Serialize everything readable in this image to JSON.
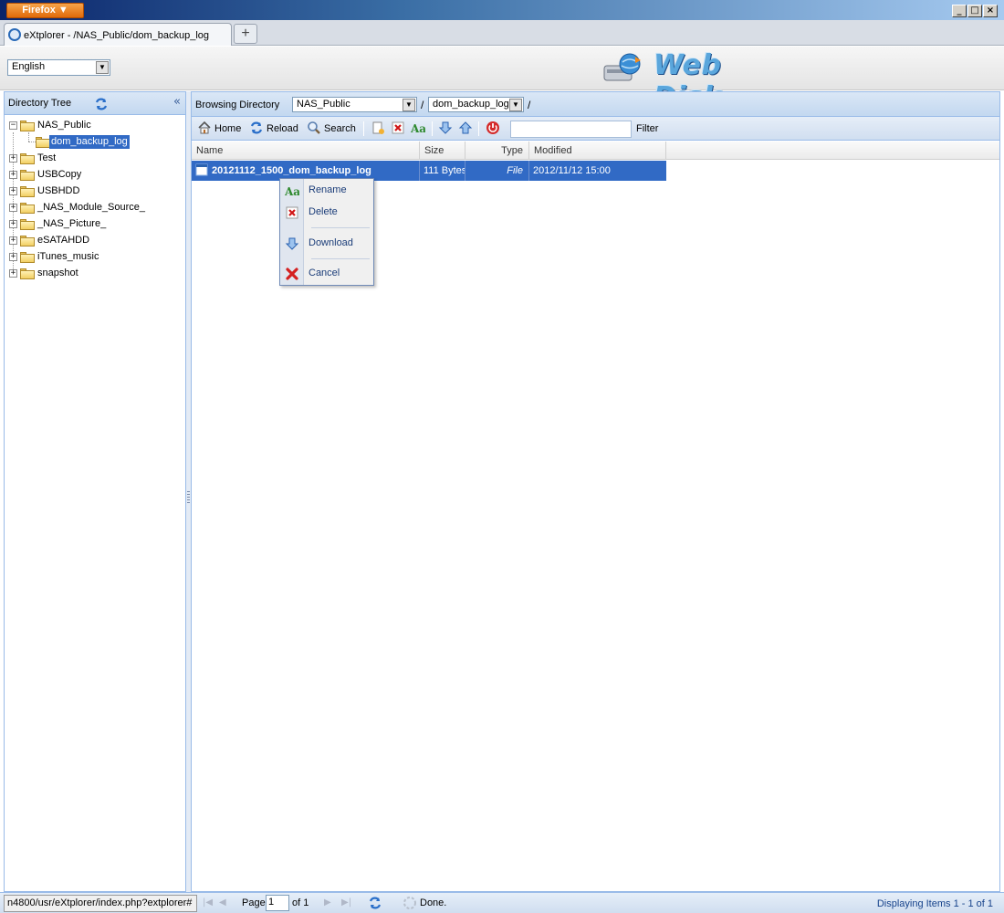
{
  "window": {
    "browser_button": "Firefox ▼",
    "minimize": "_",
    "maximize": "□",
    "close": "×",
    "tab_title": "eXtplorer - /NAS_Public/dom_backup_log",
    "new_tab": "+"
  },
  "header": {
    "language": "English",
    "logo_text": "Web Disk"
  },
  "tree": {
    "title": "Directory Tree",
    "collapse": "«",
    "nodes": [
      {
        "label": "NAS_Public",
        "expanded": true
      },
      {
        "label": "dom_backup_log",
        "selected": true
      },
      {
        "label": "Test"
      },
      {
        "label": "USBCopy"
      },
      {
        "label": "USBHDD"
      },
      {
        "label": "_NAS_Module_Source_"
      },
      {
        "label": "_NAS_Picture_"
      },
      {
        "label": "eSATAHDD"
      },
      {
        "label": "iTunes_music"
      },
      {
        "label": "snapshot"
      }
    ]
  },
  "browse": {
    "label": "Browsing Directory",
    "dir1": "NAS_Public",
    "dir2": "dom_backup_log",
    "sep": "/"
  },
  "toolbar": {
    "home": "Home",
    "reload": "Reload",
    "search": "Search",
    "filter": "Filter"
  },
  "grid": {
    "columns": [
      "Name",
      "Size",
      "Type",
      "Modified"
    ],
    "rows": [
      {
        "name": "20121112_1500_dom_backup_log",
        "size": "111 Bytes",
        "type": "File",
        "modified": "2012/11/12 15:00"
      }
    ]
  },
  "context_menu": {
    "rename": "Rename",
    "delete": "Delete",
    "download": "Download",
    "cancel": "Cancel"
  },
  "status": {
    "url": "n4800/usr/eXtplorer/index.php?extplorer#",
    "page_label": "Page",
    "page_value": "1",
    "page_of": "of 1",
    "done": "Done.",
    "displaying": "Displaying Items 1 - 1 of 1"
  }
}
